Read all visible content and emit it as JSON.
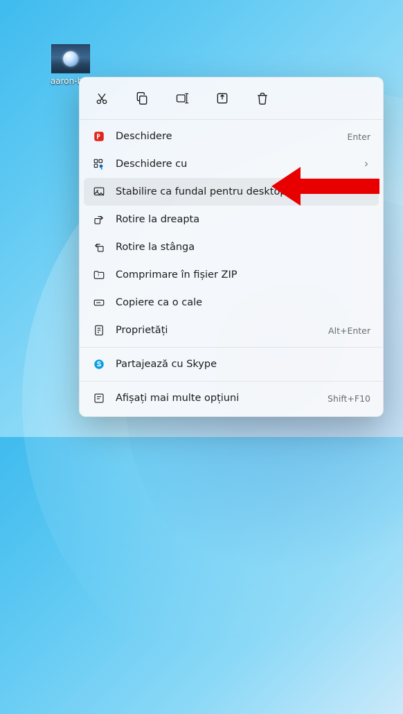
{
  "desktop": {
    "icon_label": "aaron-b…"
  },
  "menu": {
    "icon_row": [
      "cut",
      "copy",
      "rename",
      "share",
      "delete"
    ],
    "items": [
      {
        "id": "open",
        "label": "Deschidere",
        "accel": "Enter",
        "icon": "open-with-app"
      },
      {
        "id": "open-with",
        "label": "Deschidere cu",
        "submenu": true,
        "icon": "open-with"
      },
      {
        "id": "set-desktop",
        "label": "Stabilire ca fundal pentru desktop",
        "hovered": true,
        "icon": "image"
      },
      {
        "id": "rotate-right",
        "label": "Rotire la dreapta",
        "icon": "rotate-r"
      },
      {
        "id": "rotate-left",
        "label": "Rotire la stânga",
        "icon": "rotate-l"
      },
      {
        "id": "compress",
        "label": "Comprimare în fișier ZIP",
        "icon": "zip"
      },
      {
        "id": "copy-path",
        "label": "Copiere ca o cale",
        "icon": "path"
      },
      {
        "id": "properties",
        "label": "Proprietăți",
        "accel": "Alt+Enter",
        "icon": "properties"
      }
    ],
    "skype": {
      "label": "Partajează cu Skype"
    },
    "more": {
      "label": "Afișați mai multe opțiuni",
      "accel": "Shift+F10"
    }
  }
}
